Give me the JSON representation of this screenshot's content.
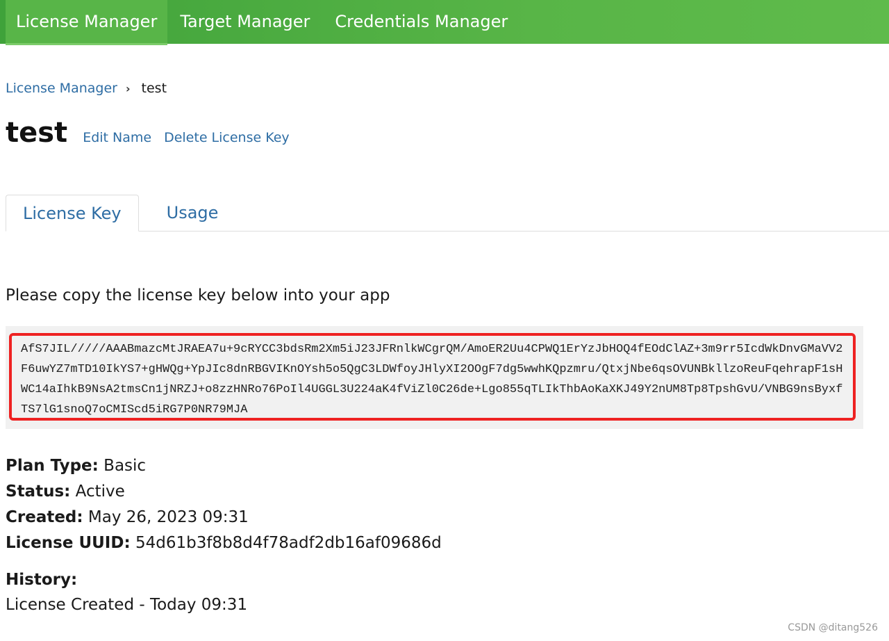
{
  "topnav": {
    "items": [
      {
        "label": "License Manager",
        "active": true
      },
      {
        "label": "Target Manager",
        "active": false
      },
      {
        "label": "Credentials Manager",
        "active": false
      }
    ]
  },
  "breadcrumb": {
    "parent": "License Manager",
    "separator": "›",
    "current": "test"
  },
  "page": {
    "title": "test",
    "edit_name_label": "Edit Name",
    "delete_label": "Delete License Key"
  },
  "tabs": [
    {
      "label": "License Key",
      "active": true
    },
    {
      "label": "Usage",
      "active": false
    }
  ],
  "license": {
    "instructions": "Please copy the license key below into your app",
    "key": "AfS7JIL/////AAABmazcMtJRAEA7u+9cRYCC3bdsRm2Xm5iJ23JFRnlkWCgrQM/AmoER2Uu4CPWQ1ErYzJbHOQ4fEOdClAZ+3m9rr5IcdWkDnvGMaVV2F6uwYZ7mTD10IkYS7+gHWQg+YpJIc8dnRBGVIKnOYsh5o5QgC3LDWfoyJHlyXI2OOgF7dg5wwhKQpzmru/QtxjNbe6qsOVUNBkllzoReuFqehrapF1sHWC14aIhkB9NsA2tmsCn1jNRZJ+o8zzHNRo76PoIl4UGGL3U224aK4fViZl0C26de+Lgo855qTLIkThbAoKaXKJ49Y2nUM8Tp8TpshGvU/VNBG9nsByxfTS7lG1snoQ7oCMIScd5iRG7P0NR79MJA"
  },
  "details": {
    "plan_type_label": "Plan Type:",
    "plan_type": "Basic",
    "status_label": "Status:",
    "status": "Active",
    "created_label": "Created:",
    "created": "May 26, 2023 09:31",
    "uuid_label": "License UUID:",
    "uuid": "54d61b3f8b8d4f78adf2db16af09686d"
  },
  "history": {
    "label": "History:",
    "entries": [
      "License Created - Today 09:31"
    ]
  },
  "watermark": "CSDN @ditang526",
  "colors": {
    "nav_green": "#58b547",
    "link_blue": "#2e6da4",
    "highlight_red": "#ee2222",
    "key_background": "#f1f1f1"
  }
}
